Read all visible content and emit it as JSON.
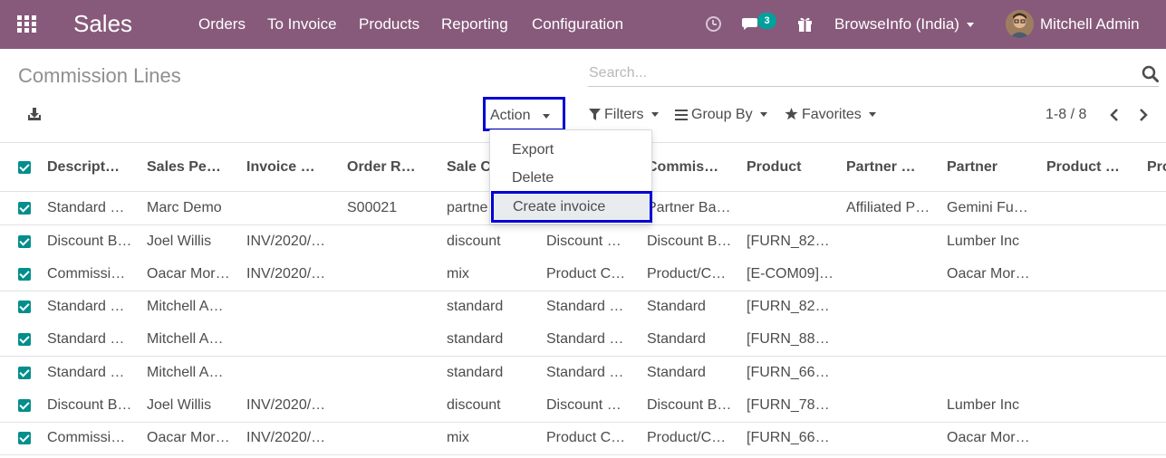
{
  "navbar": {
    "app_name": "Sales",
    "menu": [
      "Orders",
      "To Invoice",
      "Products",
      "Reporting",
      "Configuration"
    ],
    "messages_count": "3",
    "company": "BrowseInfo (India)",
    "user": "Mitchell Admin"
  },
  "control": {
    "title": "Commission Lines",
    "search_placeholder": "Search...",
    "action_label": "Action",
    "filters_label": "Filters",
    "groupby_label": "Group By",
    "favorites_label": "Favorites",
    "pager": "1-8 / 8"
  },
  "dropdown": {
    "items": [
      "Export",
      "Delete",
      "Create invoice"
    ]
  },
  "table": {
    "headers": [
      "Descript…",
      "Sales Pe…",
      "Invoice …",
      "Order R…",
      "Sale C…",
      "",
      "Commis…",
      "Product",
      "Partner …",
      "Partner",
      "Product …",
      "Pro"
    ],
    "rows": [
      [
        "Standard …",
        "Marc Demo",
        "",
        "S00021",
        "partne…",
        "",
        "Partner Ba…",
        "",
        "Affiliated P…",
        "Gemini Fu…",
        "",
        ""
      ],
      [
        "Discount B…",
        "Joel Willis",
        "INV/2020/…",
        "",
        "discount",
        "Discount …",
        "Discount B…",
        "[FURN_82…",
        "",
        "Lumber Inc",
        "",
        ""
      ],
      [
        "Commissi…",
        "Oacar Mor…",
        "INV/2020/…",
        "",
        "mix",
        "Product C…",
        "Product/C…",
        "[E-COM09]…",
        "",
        "Oacar Mor…",
        "",
        ""
      ],
      [
        "Standard …",
        "Mitchell A…",
        "",
        "",
        "standard",
        "Standard …",
        "Standard",
        "[FURN_82…",
        "",
        "",
        "",
        ""
      ],
      [
        "Standard …",
        "Mitchell A…",
        "",
        "",
        "standard",
        "Standard …",
        "Standard",
        "[FURN_88…",
        "",
        "",
        "",
        ""
      ],
      [
        "Standard …",
        "Mitchell A…",
        "",
        "",
        "standard",
        "Standard …",
        "Standard",
        "[FURN_66…",
        "",
        "",
        "",
        ""
      ],
      [
        "Discount B…",
        "Joel Willis",
        "INV/2020/…",
        "",
        "discount",
        "Discount …",
        "Discount B…",
        "[FURN_78…",
        "",
        "Lumber Inc",
        "",
        ""
      ],
      [
        "Commissi…",
        "Oacar Mor…",
        "INV/2020/…",
        "",
        "mix",
        "Product C…",
        "Product/C…",
        "[FURN_66…",
        "",
        "Oacar Mor…",
        "",
        ""
      ]
    ]
  },
  "colors": {
    "navbar": "#875a7b",
    "checkbox": "#018e8d",
    "badge": "#00a09d",
    "highlight_border": "#0000d4"
  }
}
